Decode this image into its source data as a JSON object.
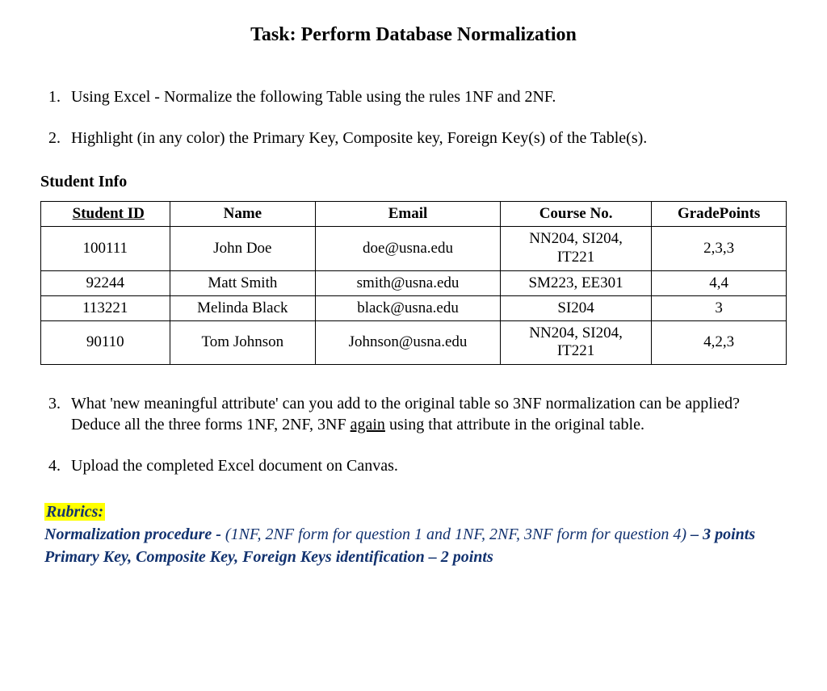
{
  "title": "Task: Perform Database Normalization",
  "items": {
    "q1": "Using Excel - Normalize the following Table using the rules 1NF and 2NF.",
    "q2": "Highlight (in any color) the Primary Key, Composite key, Foreign Key(s) of the Table(s).",
    "q3_prefix": "What 'new meaningful attribute' can you add to the original table so 3NF normalization can be applied?  Deduce all the three forms 1NF, 2NF, 3NF ",
    "q3_underlined": "again",
    "q3_suffix": " using that attribute in the original table.",
    "q4": "Upload the completed Excel document on Canvas."
  },
  "table_section_heading": "Student Info",
  "table": {
    "headers": {
      "student_id": " Student ID",
      "name": "Name",
      "email": "Email",
      "course_no": "Course No.",
      "gradepoints": "GradePoints"
    },
    "rows": [
      {
        "student_id": "100111",
        "name": "John Doe",
        "email": "doe@usna.edu",
        "course_no_line1": "NN204, SI204,",
        "course_no_line2": "IT221",
        "gradepoints": "2,3,3"
      },
      {
        "student_id": "92244",
        "name": "Matt Smith",
        "email": "smith@usna.edu",
        "course_no_line1": "SM223, EE301",
        "course_no_line2": "",
        "gradepoints": "4,4"
      },
      {
        "student_id": "113221",
        "name": "Melinda Black",
        "email": "black@usna.edu",
        "course_no_line1": "SI204",
        "course_no_line2": "",
        "gradepoints": "3"
      },
      {
        "student_id": "90110",
        "name": "Tom Johnson",
        "email": "Johnson@usna.edu",
        "course_no_line1": "NN204, SI204,",
        "course_no_line2": "IT221",
        "gradepoints": "4,2,3"
      }
    ]
  },
  "rubrics": {
    "label": "Rubrics:",
    "line1_bold_a": "Normalization procedure - ",
    "line1_italic": "(1NF, 2NF form for question 1 and 1NF, 2NF, 3NF form for question 4)",
    "line1_bold_b": " – 3 points",
    "line2": "Primary Key, Composite Key, Foreign Keys identification – 2 points"
  }
}
